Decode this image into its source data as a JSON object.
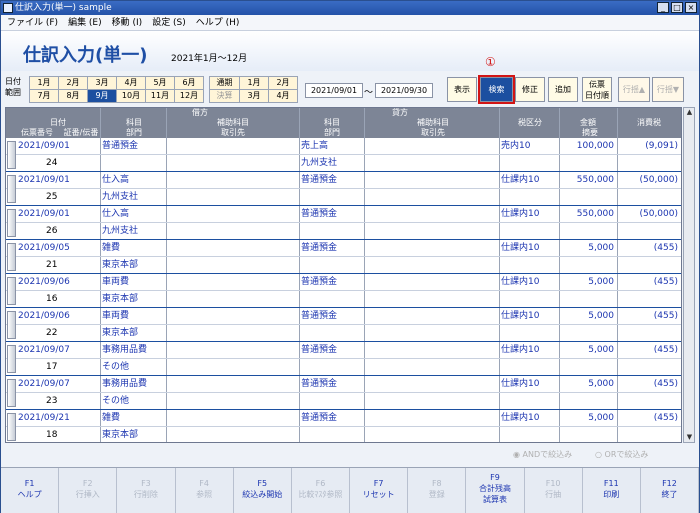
{
  "window": {
    "title": "仕訳入力(単一) sample"
  },
  "menu": [
    "ファイル (F)",
    "編集 (E)",
    "移動 (I)",
    "設定 (S)",
    "ヘルプ (H)"
  ],
  "page": {
    "title": "仕訳入力(単一)",
    "period": "2021年1月～12月",
    "annotation": "①"
  },
  "range": {
    "label1": "日付",
    "label2": "範囲",
    "months": [
      "1月",
      "2月",
      "3月",
      "4月",
      "5月",
      "6月",
      "7月",
      "8月",
      "9月",
      "10月",
      "11月",
      "12月"
    ],
    "selected_month": "9月",
    "special": [
      "通期",
      "決算"
    ],
    "quarters": [
      "1月",
      "2月",
      "3月",
      "4月"
    ],
    "from": "2021/09/01",
    "tilde": "～",
    "to": "2021/09/30"
  },
  "buttons": {
    "show": "表示",
    "search": "検索",
    "modify": "修正",
    "add": "追加",
    "slip_order_1": "伝票",
    "slip_order_2": "日付順",
    "row_up": "行揺▲",
    "row_down": "行揺▼"
  },
  "headers": {
    "debit": "借方",
    "credit": "貸方",
    "date": "日付",
    "slip_no": "伝票番号",
    "voucher": "証番/伝番",
    "subject": "科目",
    "aux_subject": "補助科目",
    "dept": "部門",
    "partner": "取引先",
    "tax_class": "税区分",
    "amount": "金額",
    "tax": "消費税",
    "summary": "摘要"
  },
  "rows": [
    {
      "date": "2021/09/01",
      "no": "24",
      "debit": "普通預金",
      "debit_dept": "",
      "credit": "売上高",
      "credit_dept": "九州支社",
      "tax_class": "売内10",
      "amount": "100,000",
      "tax": "(9,091)"
    },
    {
      "date": "2021/09/01",
      "no": "25",
      "debit": "仕入高",
      "debit_dept": "九州支社",
      "credit": "普通預金",
      "credit_dept": "",
      "tax_class": "仕課内10",
      "amount": "550,000",
      "tax": "(50,000)"
    },
    {
      "date": "2021/09/01",
      "no": "26",
      "debit": "仕入高",
      "debit_dept": "九州支社",
      "credit": "普通預金",
      "credit_dept": "",
      "tax_class": "仕課内10",
      "amount": "550,000",
      "tax": "(50,000)"
    },
    {
      "date": "2021/09/05",
      "no": "21",
      "debit": "雑費",
      "debit_dept": "東京本部",
      "credit": "普通預金",
      "credit_dept": "",
      "tax_class": "仕課内10",
      "amount": "5,000",
      "tax": "(455)"
    },
    {
      "date": "2021/09/06",
      "no": "16",
      "debit": "車両費",
      "debit_dept": "東京本部",
      "credit": "普通預金",
      "credit_dept": "",
      "tax_class": "仕課内10",
      "amount": "5,000",
      "tax": "(455)"
    },
    {
      "date": "2021/09/06",
      "no": "22",
      "debit": "車両費",
      "debit_dept": "東京本部",
      "credit": "普通預金",
      "credit_dept": "",
      "tax_class": "仕課内10",
      "amount": "5,000",
      "tax": "(455)"
    },
    {
      "date": "2021/09/07",
      "no": "17",
      "debit": "事務用品費",
      "debit_dept": "その他",
      "credit": "普通預金",
      "credit_dept": "",
      "tax_class": "仕課内10",
      "amount": "5,000",
      "tax": "(455)"
    },
    {
      "date": "2021/09/07",
      "no": "23",
      "debit": "事務用品費",
      "debit_dept": "その他",
      "credit": "普通預金",
      "credit_dept": "",
      "tax_class": "仕課内10",
      "amount": "5,000",
      "tax": "(455)"
    },
    {
      "date": "2021/09/21",
      "no": "18",
      "debit": "雑費",
      "debit_dept": "東京本部",
      "credit": "普通預金",
      "credit_dept": "",
      "tax_class": "仕課内10",
      "amount": "5,000",
      "tax": "(455)"
    }
  ],
  "filters": {
    "and": "ANDで絞込み",
    "or": "ORで絞込み"
  },
  "fkeys": [
    {
      "key": "F1",
      "label": "ヘルプ",
      "enabled": true
    },
    {
      "key": "F2",
      "label": "行挿入",
      "enabled": false
    },
    {
      "key": "F3",
      "label": "行削除",
      "enabled": false
    },
    {
      "key": "F4",
      "label": "参照",
      "enabled": false
    },
    {
      "key": "F5",
      "label": "絞込み開始",
      "enabled": true
    },
    {
      "key": "F6",
      "label": "比較ﾏｽﾀ参照",
      "enabled": false
    },
    {
      "key": "F7",
      "label": "リセット",
      "enabled": true
    },
    {
      "key": "F8",
      "label": "登録",
      "enabled": false
    },
    {
      "key": "F9",
      "label": "合計残高",
      "label2": "試算表",
      "enabled": true
    },
    {
      "key": "F10",
      "label": "行抽",
      "enabled": false
    },
    {
      "key": "F11",
      "label": "印刷",
      "enabled": true
    },
    {
      "key": "F12",
      "label": "終了",
      "enabled": true
    }
  ]
}
